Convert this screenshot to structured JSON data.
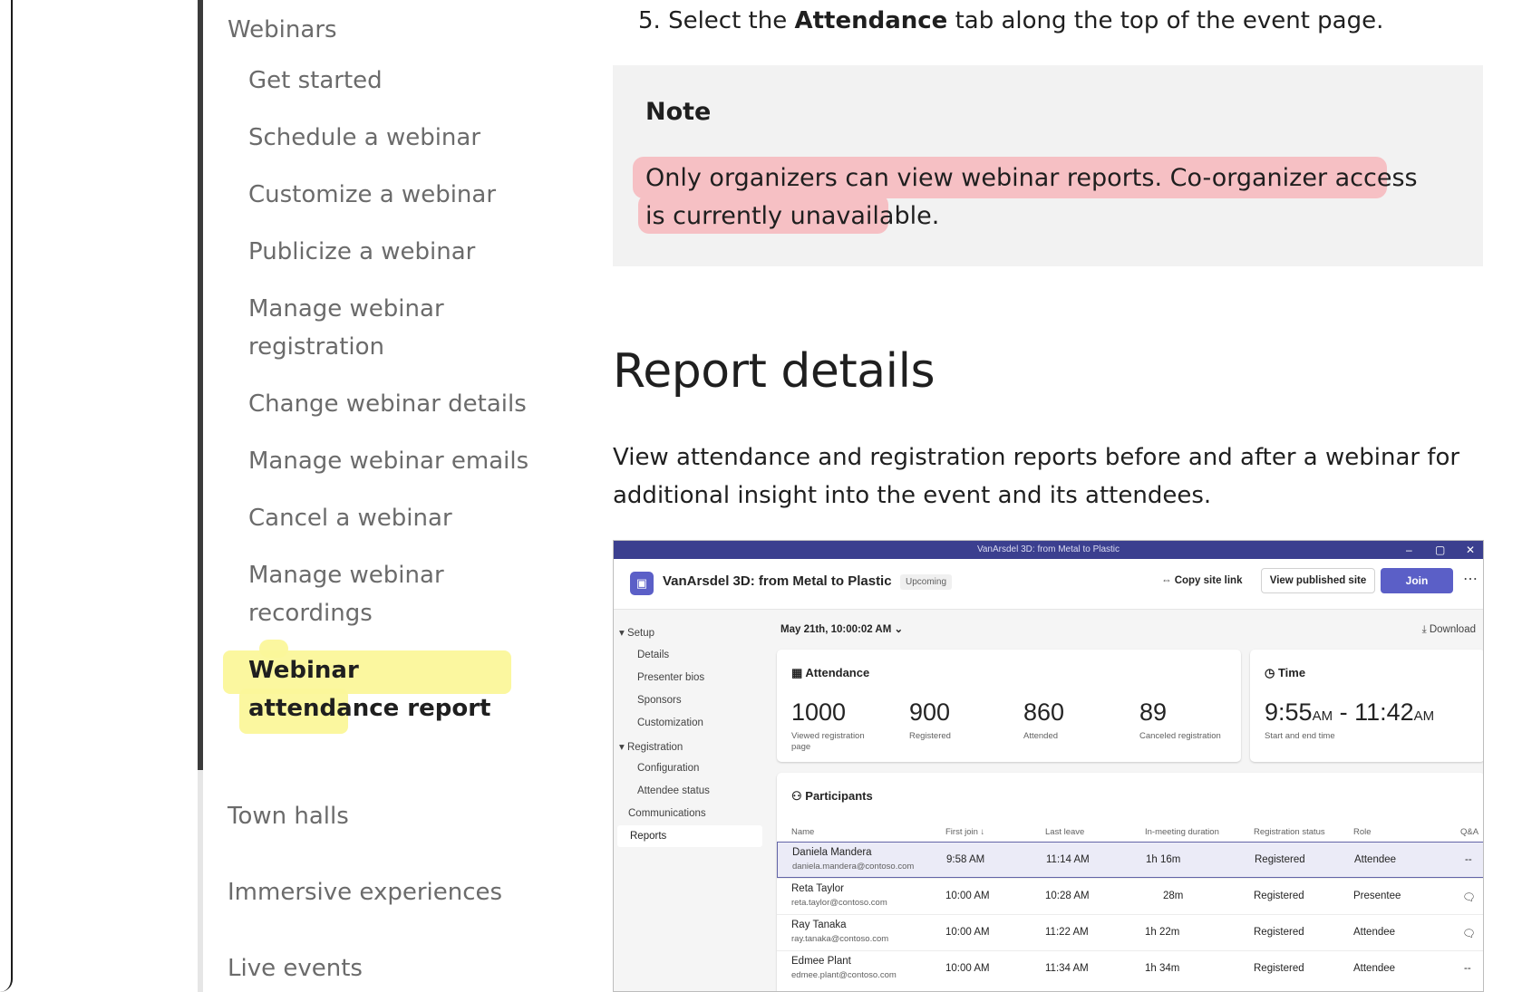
{
  "nav": {
    "section_webinars": "Webinars",
    "items": [
      {
        "label": "Get started"
      },
      {
        "label": "Schedule a webinar"
      },
      {
        "label": "Customize a webinar"
      },
      {
        "label": "Publicize a webinar"
      },
      {
        "label": "Manage webinar registration"
      },
      {
        "label": "Change webinar details"
      },
      {
        "label": "Manage webinar emails"
      },
      {
        "label": "Cancel a webinar"
      },
      {
        "label": "Manage webinar recordings"
      },
      {
        "label": "Webinar attendance report"
      }
    ],
    "section_town_halls": "Town halls",
    "section_immersive": "Immersive experiences",
    "section_live_events": "Live events"
  },
  "step": {
    "prefix": "5. Select the ",
    "bold": "Attendance",
    "suffix": " tab along the top of the event page."
  },
  "note": {
    "title": "Note",
    "text": "Only organizers can view webinar reports. Co-organizer access is currently unavailable."
  },
  "section": {
    "heading": "Report details",
    "paragraph": "View attendance and registration reports before and after a webinar for additional insight into the event and its attendees."
  },
  "screenshot": {
    "window_title": "VanArsdel 3D: from Metal to Plastic",
    "event_title": "VanArsdel 3D: from Metal to Plastic",
    "status": "Upcoming",
    "copy_link": "Copy site link",
    "view_site": "View published site",
    "join": "Join",
    "date": "May 21th, 10:00:02 AM",
    "download": "Download",
    "side": {
      "setup": "Setup",
      "details": "Details",
      "presenter_bios": "Presenter bios",
      "sponsors": "Sponsors",
      "customization": "Customization",
      "registration": "Registration",
      "configuration": "Configuration",
      "attendee_status": "Attendee status",
      "communications": "Communications",
      "reports": "Reports"
    },
    "attendance": {
      "title": "Attendance",
      "stats": [
        {
          "value": "1000",
          "label": "Viewed registration page"
        },
        {
          "value": "900",
          "label": "Registered"
        },
        {
          "value": "860",
          "label": "Attended"
        },
        {
          "value": "89",
          "label": "Canceled registration"
        }
      ]
    },
    "time": {
      "title": "Time",
      "start": "9:55",
      "start_ampm": "AM",
      "sep": " - ",
      "end": "11:42",
      "end_ampm": "AM",
      "label": "Start and end time"
    },
    "participants": {
      "title": "Participants",
      "columns": [
        "Name",
        "First join ↓",
        "Last leave",
        "In-meeting duration",
        "Registration status",
        "Role",
        "Q&A"
      ],
      "rows": [
        {
          "name": "Daniela Mandera",
          "email": "daniela.mandera@contoso.com",
          "first_join": "9:58 AM",
          "last_leave": "11:14 AM",
          "duration": "1h 16m",
          "status": "Registered",
          "role": "Attendee",
          "qa": "--"
        },
        {
          "name": "Reta Taylor",
          "email": "reta.taylor@contoso.com",
          "first_join": "10:00 AM",
          "last_leave": "10:28 AM",
          "duration": "28m",
          "status": "Registered",
          "role": "Presentee",
          "qa": "chat-icon"
        },
        {
          "name": "Ray Tanaka",
          "email": "ray.tanaka@contoso.com",
          "first_join": "10:00 AM",
          "last_leave": "11:22 AM",
          "duration": "1h 22m",
          "status": "Registered",
          "role": "Attendee",
          "qa": "chat-icon"
        },
        {
          "name": "Edmee Plant",
          "email": "edmee.plant@contoso.com",
          "first_join": "10:00 AM",
          "last_leave": "11:34 AM",
          "duration": "1h 34m",
          "status": "Registered",
          "role": "Attendee",
          "qa": "--"
        }
      ]
    }
  },
  "colors": {
    "highlight_yellow": "#fbf79a",
    "highlight_pink": "#f6c0c4",
    "accent": "#5b5fc7"
  }
}
